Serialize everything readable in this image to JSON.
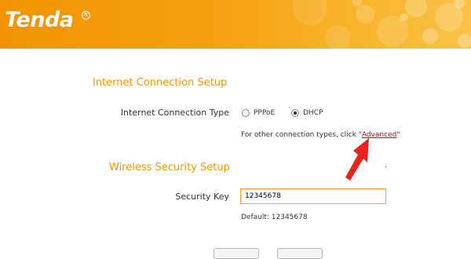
{
  "header": {
    "logo_text": "Tenda",
    "logo_mark": "R",
    "colors": {
      "orange_left": "#f29400",
      "orange_right": "#f9c246"
    }
  },
  "internet_setup": {
    "title": "Internet Connection Setup",
    "type_label": "Internet Connection Type",
    "options": [
      {
        "label": "PPPoE",
        "selected": false
      },
      {
        "label": "DHCP",
        "selected": true
      }
    ],
    "hint_prefix": "For other connection types, click \"",
    "advanced_link": "Advanced",
    "hint_suffix": "\""
  },
  "wireless_setup": {
    "title": "Wireless Security Setup",
    "key_label": "Security Key",
    "key_value": "12345678",
    "default_text": "Default: 12345678"
  },
  "colors": {
    "accent": "#f29400",
    "link": "#cc0000",
    "arrow": "#e8231b"
  }
}
